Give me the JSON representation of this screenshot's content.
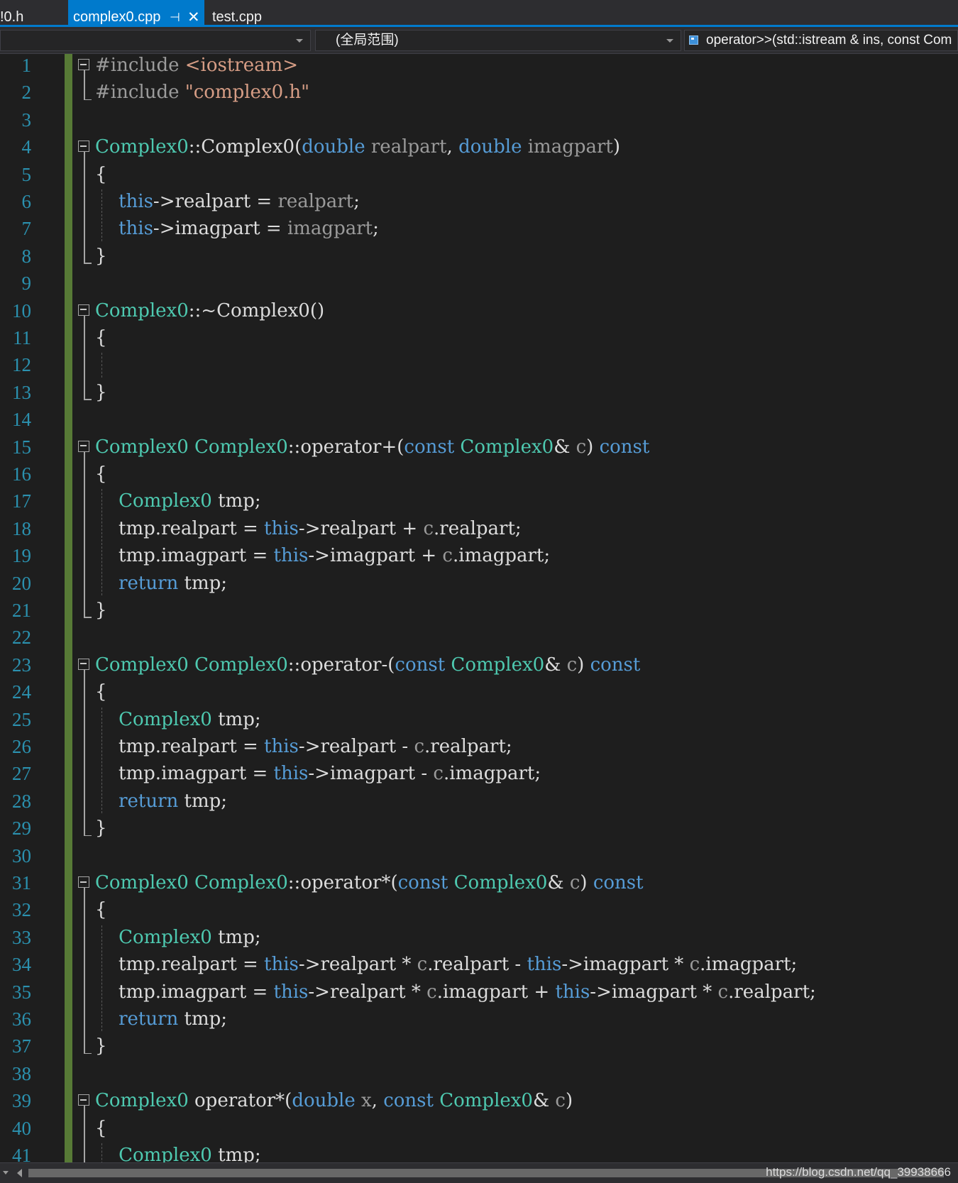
{
  "tabs": {
    "prev": "!0.h",
    "active": "complex0.cpp",
    "test": "test.cpp",
    "pin_glyph": "⊣",
    "close_glyph": "✕"
  },
  "nav": {
    "project": "",
    "scope": "(全局范围)",
    "member": "operator>>(std::istream & ins, const Com"
  },
  "line_numbers": [
    "1",
    "2",
    "3",
    "4",
    "5",
    "6",
    "7",
    "8",
    "9",
    "10",
    "11",
    "12",
    "13",
    "14",
    "15",
    "16",
    "17",
    "18",
    "19",
    "20",
    "21",
    "22",
    "23",
    "24",
    "25",
    "26",
    "27",
    "28",
    "29",
    "30",
    "31",
    "32",
    "33",
    "34",
    "35",
    "36",
    "37",
    "38",
    "39",
    "40",
    "41"
  ],
  "code_lines": [
    [
      [
        "pre",
        "#include "
      ],
      [
        "str",
        "<iostream>"
      ]
    ],
    [
      [
        "pre",
        "#include "
      ],
      [
        "str",
        "\"complex0.h\""
      ]
    ],
    [],
    [
      [
        "type",
        "Complex0"
      ],
      [
        "plain",
        "::"
      ],
      [
        "plain",
        "Complex0"
      ],
      [
        "plain",
        "("
      ],
      [
        "kw",
        "double"
      ],
      [
        "plain",
        " "
      ],
      [
        "param",
        "realpart"
      ],
      [
        "plain",
        ", "
      ],
      [
        "kw",
        "double"
      ],
      [
        "plain",
        " "
      ],
      [
        "param",
        "imagpart"
      ],
      [
        "plain",
        ")"
      ]
    ],
    [
      [
        "plain",
        "{"
      ]
    ],
    [
      [
        "plain",
        "    "
      ],
      [
        "kw",
        "this"
      ],
      [
        "plain",
        "->realpart = "
      ],
      [
        "param",
        "realpart"
      ],
      [
        "plain",
        ";"
      ]
    ],
    [
      [
        "plain",
        "    "
      ],
      [
        "kw",
        "this"
      ],
      [
        "plain",
        "->imagpart = "
      ],
      [
        "param",
        "imagpart"
      ],
      [
        "plain",
        ";"
      ]
    ],
    [
      [
        "plain",
        "}"
      ]
    ],
    [],
    [
      [
        "type",
        "Complex0"
      ],
      [
        "plain",
        "::~Complex0()"
      ]
    ],
    [
      [
        "plain",
        "{"
      ]
    ],
    [],
    [
      [
        "plain",
        "}"
      ]
    ],
    [],
    [
      [
        "type",
        "Complex0"
      ],
      [
        "plain",
        " "
      ],
      [
        "type",
        "Complex0"
      ],
      [
        "plain",
        "::operator+("
      ],
      [
        "kw",
        "const"
      ],
      [
        "plain",
        " "
      ],
      [
        "type",
        "Complex0"
      ],
      [
        "plain",
        "& "
      ],
      [
        "param",
        "c"
      ],
      [
        "plain",
        ") "
      ],
      [
        "kw",
        "const"
      ]
    ],
    [
      [
        "plain",
        "{"
      ]
    ],
    [
      [
        "plain",
        "    "
      ],
      [
        "type",
        "Complex0"
      ],
      [
        "plain",
        " tmp;"
      ]
    ],
    [
      [
        "plain",
        "    tmp.realpart = "
      ],
      [
        "kw",
        "this"
      ],
      [
        "plain",
        "->realpart + "
      ],
      [
        "param",
        "c"
      ],
      [
        "plain",
        ".realpart;"
      ]
    ],
    [
      [
        "plain",
        "    tmp.imagpart = "
      ],
      [
        "kw",
        "this"
      ],
      [
        "plain",
        "->imagpart + "
      ],
      [
        "param",
        "c"
      ],
      [
        "plain",
        ".imagpart;"
      ]
    ],
    [
      [
        "plain",
        "    "
      ],
      [
        "kw",
        "return"
      ],
      [
        "plain",
        " tmp;"
      ]
    ],
    [
      [
        "plain",
        "}"
      ]
    ],
    [],
    [
      [
        "type",
        "Complex0"
      ],
      [
        "plain",
        " "
      ],
      [
        "type",
        "Complex0"
      ],
      [
        "plain",
        "::operator-("
      ],
      [
        "kw",
        "const"
      ],
      [
        "plain",
        " "
      ],
      [
        "type",
        "Complex0"
      ],
      [
        "plain",
        "& "
      ],
      [
        "param",
        "c"
      ],
      [
        "plain",
        ") "
      ],
      [
        "kw",
        "const"
      ]
    ],
    [
      [
        "plain",
        "{"
      ]
    ],
    [
      [
        "plain",
        "    "
      ],
      [
        "type",
        "Complex0"
      ],
      [
        "plain",
        " tmp;"
      ]
    ],
    [
      [
        "plain",
        "    tmp.realpart = "
      ],
      [
        "kw",
        "this"
      ],
      [
        "plain",
        "->realpart - "
      ],
      [
        "param",
        "c"
      ],
      [
        "plain",
        ".realpart;"
      ]
    ],
    [
      [
        "plain",
        "    tmp.imagpart = "
      ],
      [
        "kw",
        "this"
      ],
      [
        "plain",
        "->imagpart - "
      ],
      [
        "param",
        "c"
      ],
      [
        "plain",
        ".imagpart;"
      ]
    ],
    [
      [
        "plain",
        "    "
      ],
      [
        "kw",
        "return"
      ],
      [
        "plain",
        " tmp;"
      ]
    ],
    [
      [
        "plain",
        "}"
      ]
    ],
    [],
    [
      [
        "type",
        "Complex0"
      ],
      [
        "plain",
        " "
      ],
      [
        "type",
        "Complex0"
      ],
      [
        "plain",
        "::operator*("
      ],
      [
        "kw",
        "const"
      ],
      [
        "plain",
        " "
      ],
      [
        "type",
        "Complex0"
      ],
      [
        "plain",
        "& "
      ],
      [
        "param",
        "c"
      ],
      [
        "plain",
        ") "
      ],
      [
        "kw",
        "const"
      ]
    ],
    [
      [
        "plain",
        "{"
      ]
    ],
    [
      [
        "plain",
        "    "
      ],
      [
        "type",
        "Complex0"
      ],
      [
        "plain",
        " tmp;"
      ]
    ],
    [
      [
        "plain",
        "    tmp.realpart = "
      ],
      [
        "kw",
        "this"
      ],
      [
        "plain",
        "->realpart * "
      ],
      [
        "param",
        "c"
      ],
      [
        "plain",
        ".realpart - "
      ],
      [
        "kw",
        "this"
      ],
      [
        "plain",
        "->imagpart * "
      ],
      [
        "param",
        "c"
      ],
      [
        "plain",
        ".imagpart;"
      ]
    ],
    [
      [
        "plain",
        "    tmp.imagpart = "
      ],
      [
        "kw",
        "this"
      ],
      [
        "plain",
        "->realpart * "
      ],
      [
        "param",
        "c"
      ],
      [
        "plain",
        ".imagpart + "
      ],
      [
        "kw",
        "this"
      ],
      [
        "plain",
        "->imagpart * "
      ],
      [
        "param",
        "c"
      ],
      [
        "plain",
        ".realpart;"
      ]
    ],
    [
      [
        "plain",
        "    "
      ],
      [
        "kw",
        "return"
      ],
      [
        "plain",
        " tmp;"
      ]
    ],
    [
      [
        "plain",
        "}"
      ]
    ],
    [],
    [
      [
        "type",
        "Complex0"
      ],
      [
        "plain",
        " operator*("
      ],
      [
        "kw",
        "double"
      ],
      [
        "plain",
        " "
      ],
      [
        "param",
        "x"
      ],
      [
        "plain",
        ", "
      ],
      [
        "kw",
        "const"
      ],
      [
        "plain",
        " "
      ],
      [
        "type",
        "Complex0"
      ],
      [
        "plain",
        "& "
      ],
      [
        "param",
        "c"
      ],
      [
        "plain",
        ")"
      ]
    ],
    [
      [
        "plain",
        "{"
      ]
    ],
    [
      [
        "plain",
        "    "
      ],
      [
        "type",
        "Complex0"
      ],
      [
        "plain",
        " tmp;"
      ]
    ]
  ],
  "watermark": "https://blog.csdn.net/qq_39938666",
  "colors": {
    "background": "#1e1e1e",
    "accent": "#007acc",
    "line_number": "#2b91af",
    "keyword": "#569cd6",
    "type": "#4ec9b0",
    "string": "#d69d85",
    "change_margin": "#577a36"
  }
}
